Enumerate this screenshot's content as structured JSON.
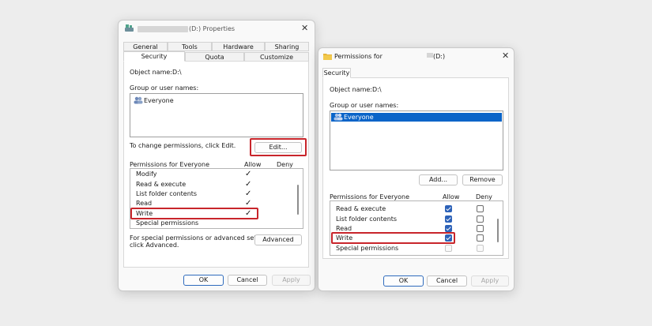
{
  "properties": {
    "title": "(D:) Properties",
    "close_glyph": "✕",
    "tabs_row1": [
      "General",
      "Tools",
      "Hardware",
      "Sharing"
    ],
    "tabs_row2": [
      "Security",
      "Quota",
      "Customize"
    ],
    "object_label": "Object name:",
    "object_value": "D:\\",
    "group_label": "Group or user names:",
    "group_users": [
      "Everyone"
    ],
    "change_text": "To change permissions, click Edit.",
    "edit_label": "Edit...",
    "perm_label": "Permissions for Everyone",
    "allow_label": "Allow",
    "deny_label": "Deny",
    "permissions": [
      {
        "name": "Modify",
        "allow": true
      },
      {
        "name": "Read & execute",
        "allow": true
      },
      {
        "name": "List folder contents",
        "allow": true
      },
      {
        "name": "Read",
        "allow": true
      },
      {
        "name": "Write",
        "allow": true
      },
      {
        "name": "Special permissions",
        "allow": false
      }
    ],
    "advanced_text_1": "For special permissions or advanced settings,",
    "advanced_text_2": "click Advanced.",
    "advanced_label": "Advanced",
    "ok_label": "OK",
    "cancel_label": "Cancel",
    "apply_label": "Apply"
  },
  "permissions_dialog": {
    "title": "Permissions for",
    "title_drive": "(D:)",
    "close_glyph": "✕",
    "tab": "Security",
    "object_label": "Object name:",
    "object_value": "D:\\",
    "group_label": "Group or user names:",
    "group_users": [
      "Everyone"
    ],
    "add_label": "Add...",
    "remove_label": "Remove",
    "perm_label": "Permissions for Everyone",
    "allow_label": "Allow",
    "deny_label": "Deny",
    "permissions": [
      {
        "name": "Read & execute",
        "allow": true,
        "deny": false
      },
      {
        "name": "List folder contents",
        "allow": true,
        "deny": false
      },
      {
        "name": "Read",
        "allow": true,
        "deny": false
      },
      {
        "name": "Write",
        "allow": true,
        "deny": false
      },
      {
        "name": "Special permissions",
        "allow": false,
        "deny": false,
        "disabled": true
      }
    ],
    "ok_label": "OK",
    "cancel_label": "Cancel",
    "apply_label": "Apply"
  },
  "colors": {
    "highlight": "#c8252b",
    "selection": "#0a64c8",
    "checkbox_checked": "#2d62b8"
  },
  "icons": [
    "drive-icon",
    "users-icon",
    "folder-icon",
    "close-icon",
    "check-icon"
  ]
}
